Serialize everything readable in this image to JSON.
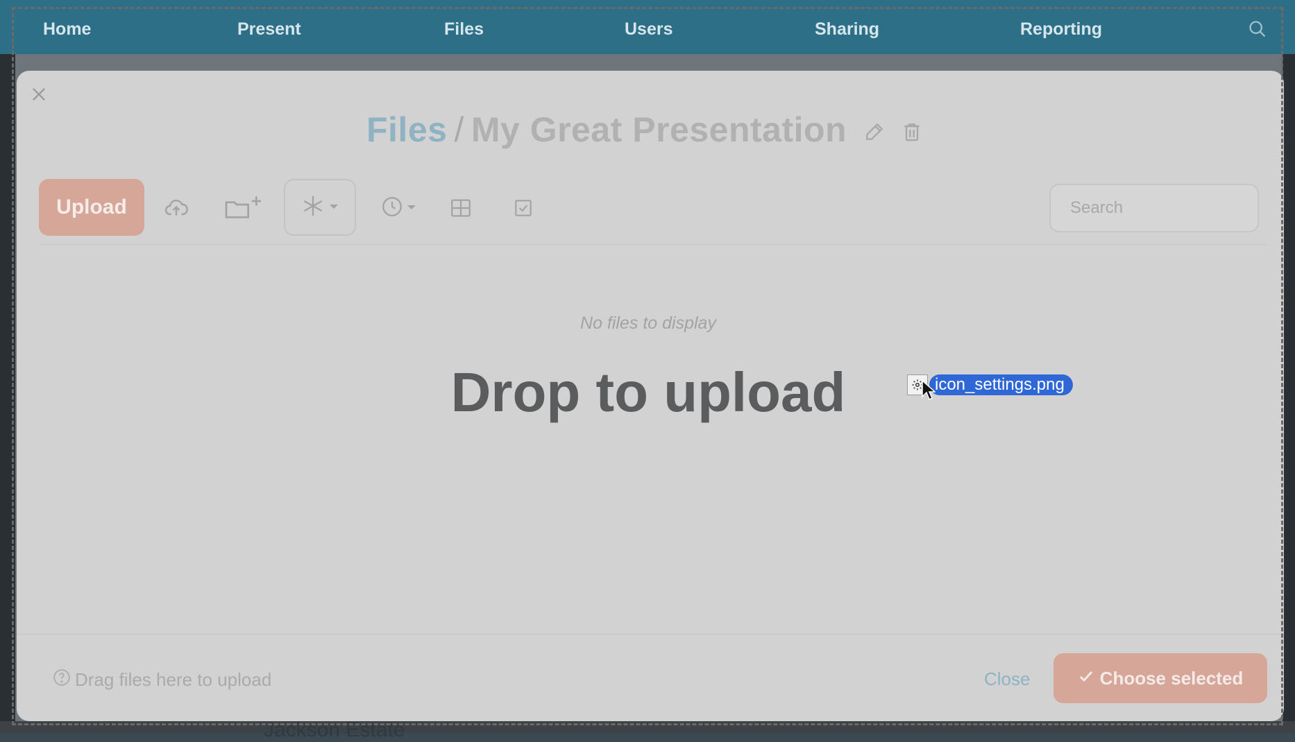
{
  "nav": {
    "items": [
      "Home",
      "Present",
      "Files",
      "Users",
      "Sharing",
      "Reporting"
    ]
  },
  "background": {
    "estate_label": "Jackson Estate"
  },
  "modal": {
    "breadcrumb": {
      "root": "Files",
      "separator": "/",
      "current": "My Great Presentation"
    },
    "upload_label": "Upload",
    "search_placeholder": "Search",
    "empty_message": "No files to display",
    "drop_message": "Drop to upload",
    "footer": {
      "help_text": "Drag files here to upload",
      "close_label": "Close",
      "choose_label": "Choose selected"
    }
  },
  "drag": {
    "filename": "icon_settings.png"
  },
  "icons": {
    "close": "close-icon",
    "edit": "pencil-icon",
    "delete": "trash-icon",
    "cloud_upload": "cloud-upload-icon",
    "new_folder": "folder-plus-icon",
    "filter": "asterisk-icon",
    "recent": "clock-icon",
    "grid": "grid-icon",
    "select": "checkbox-icon",
    "search": "search-icon",
    "help": "question-circle-icon"
  },
  "colors": {
    "accent": "#d6a698",
    "link": "#8fb3c3",
    "nav_bg": "#2d6f86",
    "drag_label": "#2f68d6"
  }
}
